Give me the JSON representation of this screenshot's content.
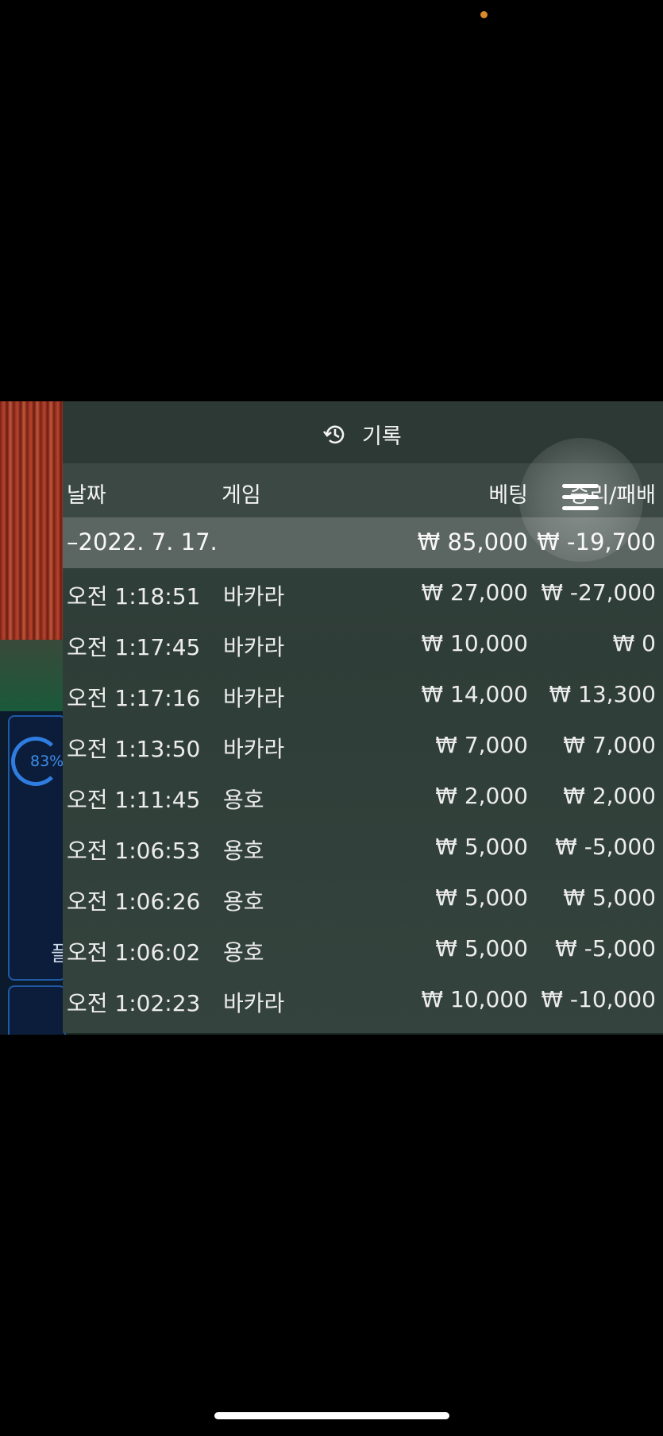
{
  "panel": {
    "title": "기록"
  },
  "columns": {
    "date": "날짜",
    "game": "게임",
    "bet": "베팅",
    "winloss": "승리/패배"
  },
  "summary": {
    "date": "–2022. 7. 17.",
    "bet": "₩ 85,000",
    "winloss": "₩ -19,700"
  },
  "rows": [
    {
      "time": "오전 1:18:51",
      "game": "바카라",
      "bet": "₩ 27,000",
      "winloss": "₩ -27,000"
    },
    {
      "time": "오전 1:17:45",
      "game": "바카라",
      "bet": "₩ 10,000",
      "winloss": "₩ 0"
    },
    {
      "time": "오전 1:17:16",
      "game": "바카라",
      "bet": "₩ 14,000",
      "winloss": "₩ 13,300"
    },
    {
      "time": "오전 1:13:50",
      "game": "바카라",
      "bet": "₩ 7,000",
      "winloss": "₩ 7,000"
    },
    {
      "time": "오전 1:11:45",
      "game": "용호",
      "bet": "₩ 2,000",
      "winloss": "₩ 2,000"
    },
    {
      "time": "오전 1:06:53",
      "game": "용호",
      "bet": "₩ 5,000",
      "winloss": "₩ -5,000"
    },
    {
      "time": "오전 1:06:26",
      "game": "용호",
      "bet": "₩ 5,000",
      "winloss": "₩ 5,000"
    },
    {
      "time": "오전 1:06:02",
      "game": "용호",
      "bet": "₩ 5,000",
      "winloss": "₩ -5,000"
    },
    {
      "time": "오전 1:02:23",
      "game": "바카라",
      "bet": "₩ 10,000",
      "winloss": "₩ -10,000"
    }
  ],
  "side_stats": {
    "percent": "83%",
    "label_char": "플"
  },
  "icons": {
    "history": "history-icon",
    "menu": "menu-icon"
  },
  "colors": {
    "panel": "#34403c",
    "accent": "#2f7de0",
    "summary_row": "#5b6561"
  }
}
